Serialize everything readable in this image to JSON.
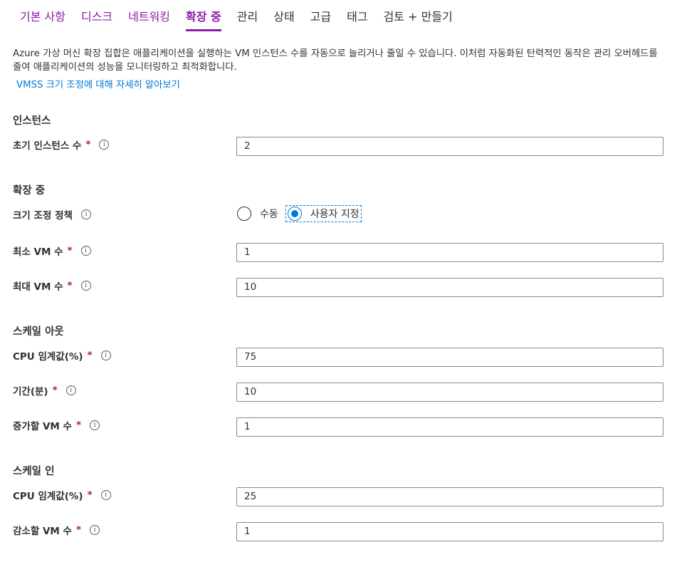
{
  "tabs": [
    {
      "label": "기본 사항"
    },
    {
      "label": "디스크"
    },
    {
      "label": "네트워킹"
    },
    {
      "label": "확장 중"
    },
    {
      "label": "관리"
    },
    {
      "label": "상태"
    },
    {
      "label": "고급"
    },
    {
      "label": "태그"
    },
    {
      "label": "검토 + 만들기"
    }
  ],
  "description": "Azure 가상 머신 확장 집합은 애플리케이션을 실행하는 VM 인스턴스 수를 자동으로 늘리거나 줄일 수 있습니다. 이처럼 자동화된 탄력적인 동작은 관리 오버헤드를 줄여 애플리케이션의 성능을 모니터링하고 최적화합니다.",
  "learn_more": "VMSS 크기 조정에 대해 자세히 알아보기",
  "required_mark": "*",
  "info_glyph": "i",
  "instances": {
    "heading": "인스턴스",
    "initial_count_label": "초기 인스턴스 수",
    "initial_count_value": "2"
  },
  "scaling": {
    "heading": "확장 중",
    "policy_label": "크기 조정 정책",
    "policy_options": [
      "수동",
      "사용자 지정"
    ],
    "policy_selected": "사용자 지정",
    "min_vm_label": "최소 VM 수",
    "min_vm_value": "1",
    "max_vm_label": "최대 VM 수",
    "max_vm_value": "10"
  },
  "scale_out": {
    "heading": "스케일 아웃",
    "cpu_label": "CPU 임계값(%)",
    "cpu_value": "75",
    "duration_label": "기간(분)",
    "duration_value": "10",
    "increase_label": "증가할 VM 수",
    "increase_value": "1"
  },
  "scale_in": {
    "heading": "스케일 인",
    "cpu_label": "CPU 임계값(%)",
    "cpu_value": "25",
    "decrease_label": "감소할 VM 수",
    "decrease_value": "1"
  },
  "colors": {
    "accent": "#8e1ba8",
    "link": "#0078d4",
    "required": "#a4262c",
    "border": "#8a8886"
  }
}
